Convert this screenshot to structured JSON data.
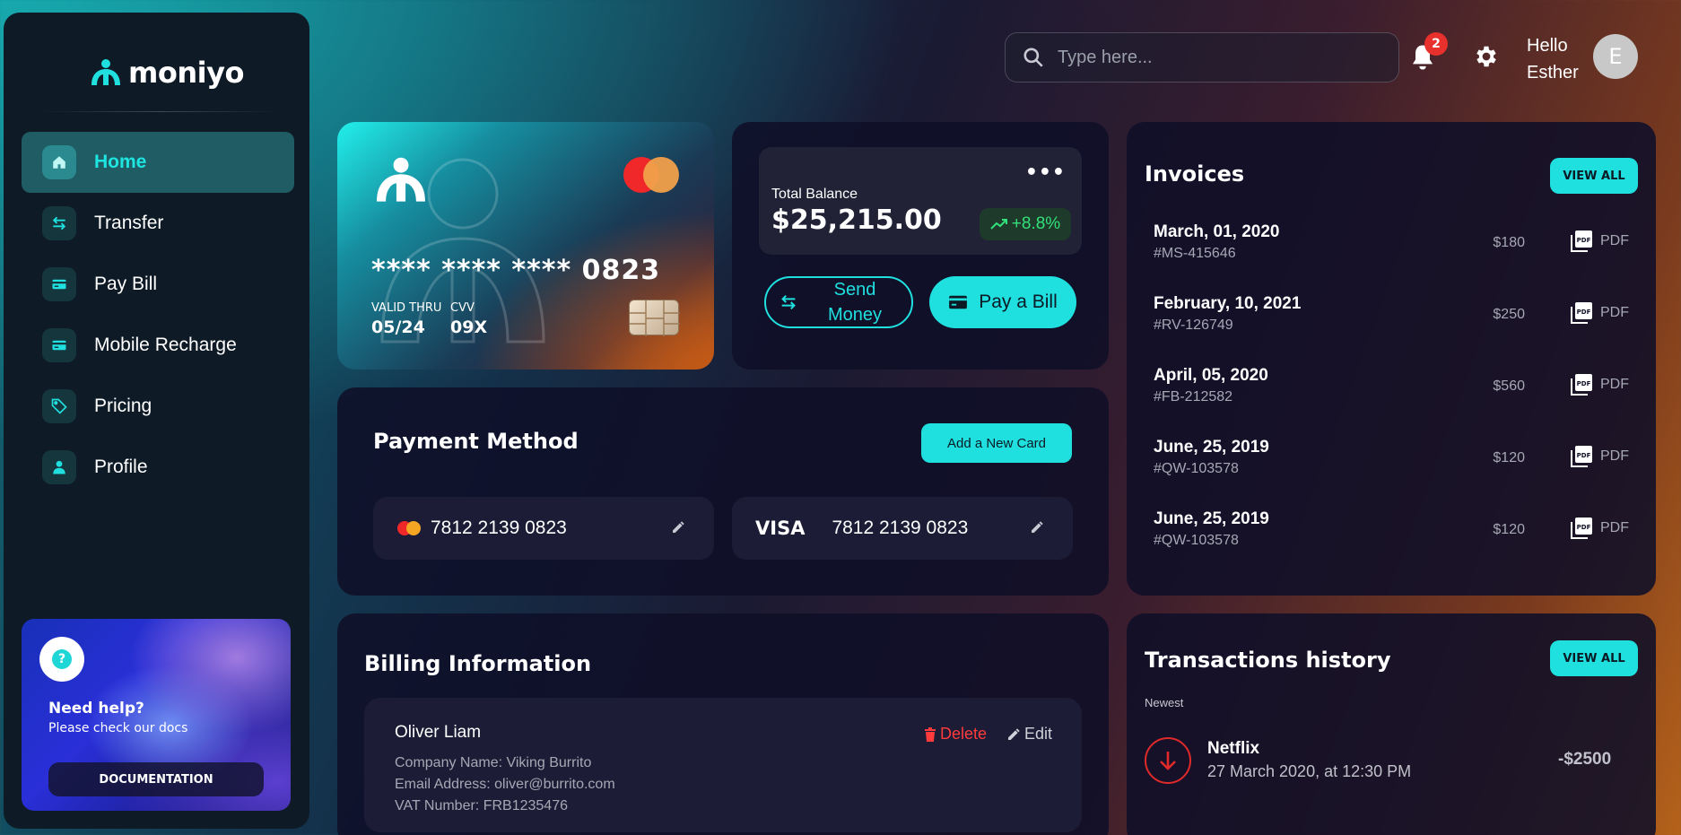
{
  "brand": {
    "name": "moniyo"
  },
  "sidebar": {
    "items": [
      {
        "label": "Home",
        "icon": "home-icon",
        "active": true
      },
      {
        "label": "Transfer",
        "icon": "transfer-icon",
        "active": false
      },
      {
        "label": "Pay Bill",
        "icon": "card-icon",
        "active": false
      },
      {
        "label": "Mobile Recharge",
        "icon": "card-icon",
        "active": false
      },
      {
        "label": "Pricing",
        "icon": "tag-icon",
        "active": false
      },
      {
        "label": "Profile",
        "icon": "person-icon",
        "active": false
      }
    ],
    "help": {
      "title": "Need help?",
      "subtitle": "Please check our docs",
      "button": "DOCUMENTATION"
    }
  },
  "header": {
    "search_placeholder": "Type here...",
    "notification_count": "2",
    "greeting_line1": "Hello",
    "greeting_line2": "Esther",
    "avatar_initial": "E"
  },
  "credit_card": {
    "masked": "**** **** ****",
    "last4": "0823",
    "valid_thru_label": "VALID THRU",
    "valid_thru": "05/24",
    "cvv_label": "CVV",
    "cvv": "09X"
  },
  "balance": {
    "label": "Total Balance",
    "value": "$25,215.00",
    "change": "+8.8%",
    "send_label": "Send Money",
    "pay_label": "Pay a Bill"
  },
  "payment_method": {
    "title": "Payment Method",
    "add_label": "Add a New Card",
    "cards": [
      {
        "brand": "mastercard",
        "number": "7812 2139 0823"
      },
      {
        "brand": "VISA",
        "number": "7812 2139 0823"
      }
    ]
  },
  "billing": {
    "title": "Billing Information",
    "entry": {
      "name": "Oliver Liam",
      "company": "Company Name: Viking Burrito",
      "email": "Email Address: oliver@burrito.com",
      "vat": "VAT Number: FRB1235476",
      "delete_label": "Delete",
      "edit_label": "Edit"
    }
  },
  "invoices": {
    "title": "Invoices",
    "view_all": "VIEW ALL",
    "rows": [
      {
        "date": "March, 01, 2020",
        "id": "#MS-415646",
        "amount": "$180",
        "pdf": "PDF"
      },
      {
        "date": "February, 10, 2021",
        "id": "#RV-126749",
        "amount": "$250",
        "pdf": "PDF"
      },
      {
        "date": "April, 05, 2020",
        "id": "#FB-212582",
        "amount": "$560",
        "pdf": "PDF"
      },
      {
        "date": "June, 25, 2019",
        "id": "#QW-103578",
        "amount": "$120",
        "pdf": "PDF"
      },
      {
        "date": "June, 25, 2019",
        "id": "#QW-103578",
        "amount": "$120",
        "pdf": "PDF"
      }
    ]
  },
  "transactions": {
    "title": "Transactions history",
    "view_all": "VIEW ALL",
    "section": "Newest",
    "items": [
      {
        "name": "Netflix",
        "date": "27 March 2020, at 12:30 PM",
        "amount": "-$2500",
        "color": "#e02a2a"
      }
    ]
  },
  "colors": {
    "accent": "#1fe0df",
    "danger": "#e8302c",
    "positive": "#34e07a"
  }
}
